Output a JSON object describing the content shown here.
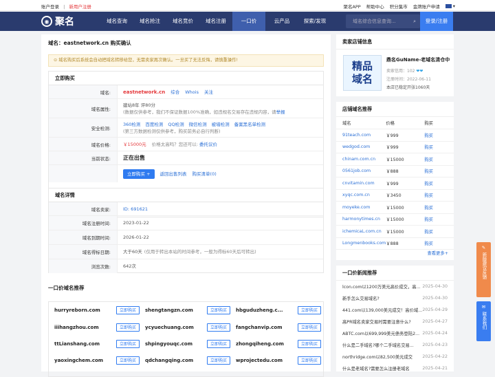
{
  "topbar": {
    "login": "账户登录",
    "divider": "|",
    "register": "新用户注册",
    "links": [
      "聚名APP",
      "帮助中心",
      "积分集市",
      "金牌账户申请"
    ]
  },
  "nav": {
    "logo": "聚名",
    "items": [
      "域名查询",
      "域名抢注",
      "域名竞价",
      "域名注册",
      "一口价",
      "云产品",
      "探索/发现"
    ],
    "search_placeholder": "域名综合信息查询...",
    "login_button": "登录/注册"
  },
  "page": {
    "title": "域名：eastnetwork.cn 购买确认",
    "notice": "⊙ 域名购买后系统会自动把域名转移给您，无需卖家再次确认。一旦买了无法反悔，请慎重操作!"
  },
  "buy": {
    "header": "立即购买",
    "domain_label": "域名:",
    "domain": "eastnetwork.cn",
    "domain_links": [
      "综合",
      "Whois",
      "关注"
    ],
    "attr_label": "域名属性:",
    "attr_line1": "建站8年 评80分",
    "attr_line2": "(数据仅供参考，我们不保证数据100%准确，如违规名交易存在违规内容，请",
    "attr_report": "举报",
    "safe_label": "安全检测:",
    "safe_links": [
      "360检测",
      "百度检测",
      "QQ检测",
      "微信检测",
      "被墙检测",
      "备案黑名单检测"
    ],
    "safe_note": "(第三方数据检测仅供参考，购买前务必自行判断)",
    "price_label": "域名价格:",
    "price": "￥15000元",
    "price_note": "价格太高吗？您还可以:",
    "price_link": "委托议价",
    "status_label": "当前状态:",
    "status": "正在出售",
    "buy_button": "立即购买",
    "plus": "+",
    "back_link": "返回出售列表",
    "cart_link": "购买清单",
    "cart_count": "(0)"
  },
  "detail": {
    "header": "域名详情",
    "rows": [
      {
        "k": "域名卖家:",
        "v": "ID: 691621"
      },
      {
        "k": "域名注册时间:",
        "v": "2023-01-22"
      },
      {
        "k": "域名到期时间:",
        "v": "2026-01-22"
      },
      {
        "k": "域名得标日期:",
        "v": "大于60天",
        "note": "(仅用于转出本站的时间参考，一般为得标60天后可转出)"
      },
      {
        "k": "浏览次数:",
        "v": "642次"
      }
    ]
  },
  "recommend": {
    "title": "一口价域名推荐",
    "button": "立即购买",
    "domains": [
      "hurryreborn.com",
      "shengtangzn.com",
      "hbguduzheng.c...",
      "iiihangzhou.com",
      "ycyuechuang.com",
      "fangchanvip.com",
      "ttLianshang.com",
      "shpingyouqc.com",
      "zhongqiheng.com",
      "yaoxingchem.com",
      "qdchangqing.com",
      "wprojectedu.com"
    ]
  },
  "seller": {
    "header": "卖家店铺信息",
    "logo_text": [
      "精品",
      "域名"
    ],
    "name": "鼎名GuName-老域名清仓中",
    "credit_label": "卖家信用：",
    "credit": "102",
    "icons": "❤❤",
    "reg_label": "注册时间：",
    "reg": "2022-06-11",
    "desc": "本店已稳定开张1060天"
  },
  "shop": {
    "header": "店铺域名推荐",
    "cols": [
      "域名",
      "价格",
      "购买"
    ],
    "rows": [
      [
        "91teach.com",
        "￥999",
        "购买"
      ],
      [
        "wedgod.com",
        "￥999",
        "购买"
      ],
      [
        "chinam.com.cn",
        "￥15000",
        "购买"
      ],
      [
        "0561job.com",
        "￥888",
        "购买"
      ],
      [
        "cnvitamin.com",
        "￥999",
        "购买"
      ],
      [
        "xyqc.com.cn",
        "￥3450",
        "购买"
      ],
      [
        "moyeke.com",
        "￥15000",
        "购买"
      ],
      [
        "harmonytimes.cn",
        "￥15000",
        "购买"
      ],
      [
        "ichemicaL.com.cn",
        "￥15000",
        "购买"
      ],
      [
        "Longmenbooks.com",
        "￥888",
        "购买"
      ]
    ],
    "more": "查看更多+"
  },
  "news": {
    "header": "一口价新闻推荐",
    "items": [
      [
        "lcon.com以1200万美元高价成交，高...",
        "2025-04-30"
      ],
      [
        "新手怎么交易域名?",
        "2025-04-30"
      ],
      [
        "441.com以139,000美元成交！高价域...",
        "2025-04-29"
      ],
      [
        "高PR域名卖家交易时需要注意什么?",
        "2025-04-27"
      ],
      [
        "ABTC.com以699,999美元债务登陆2...",
        "2025-04-24"
      ],
      [
        "什么是二手域名?哪个二手域名交易...",
        "2025-04-23"
      ],
      [
        "northridge.com以82,500美元成交",
        "2025-04-22"
      ],
      [
        "什么是老域名?需要怎么注册老域名",
        "2025-04-21"
      ]
    ]
  },
  "float": {
    "feedback": "新版建议反馈",
    "contact": "联系我们"
  },
  "colors": {
    "nav": "#2a3b6e",
    "accent": "#2f7bf0",
    "price": "#e4393c",
    "float_orange": "#f08a4b",
    "float_blue": "#3a7df0"
  }
}
